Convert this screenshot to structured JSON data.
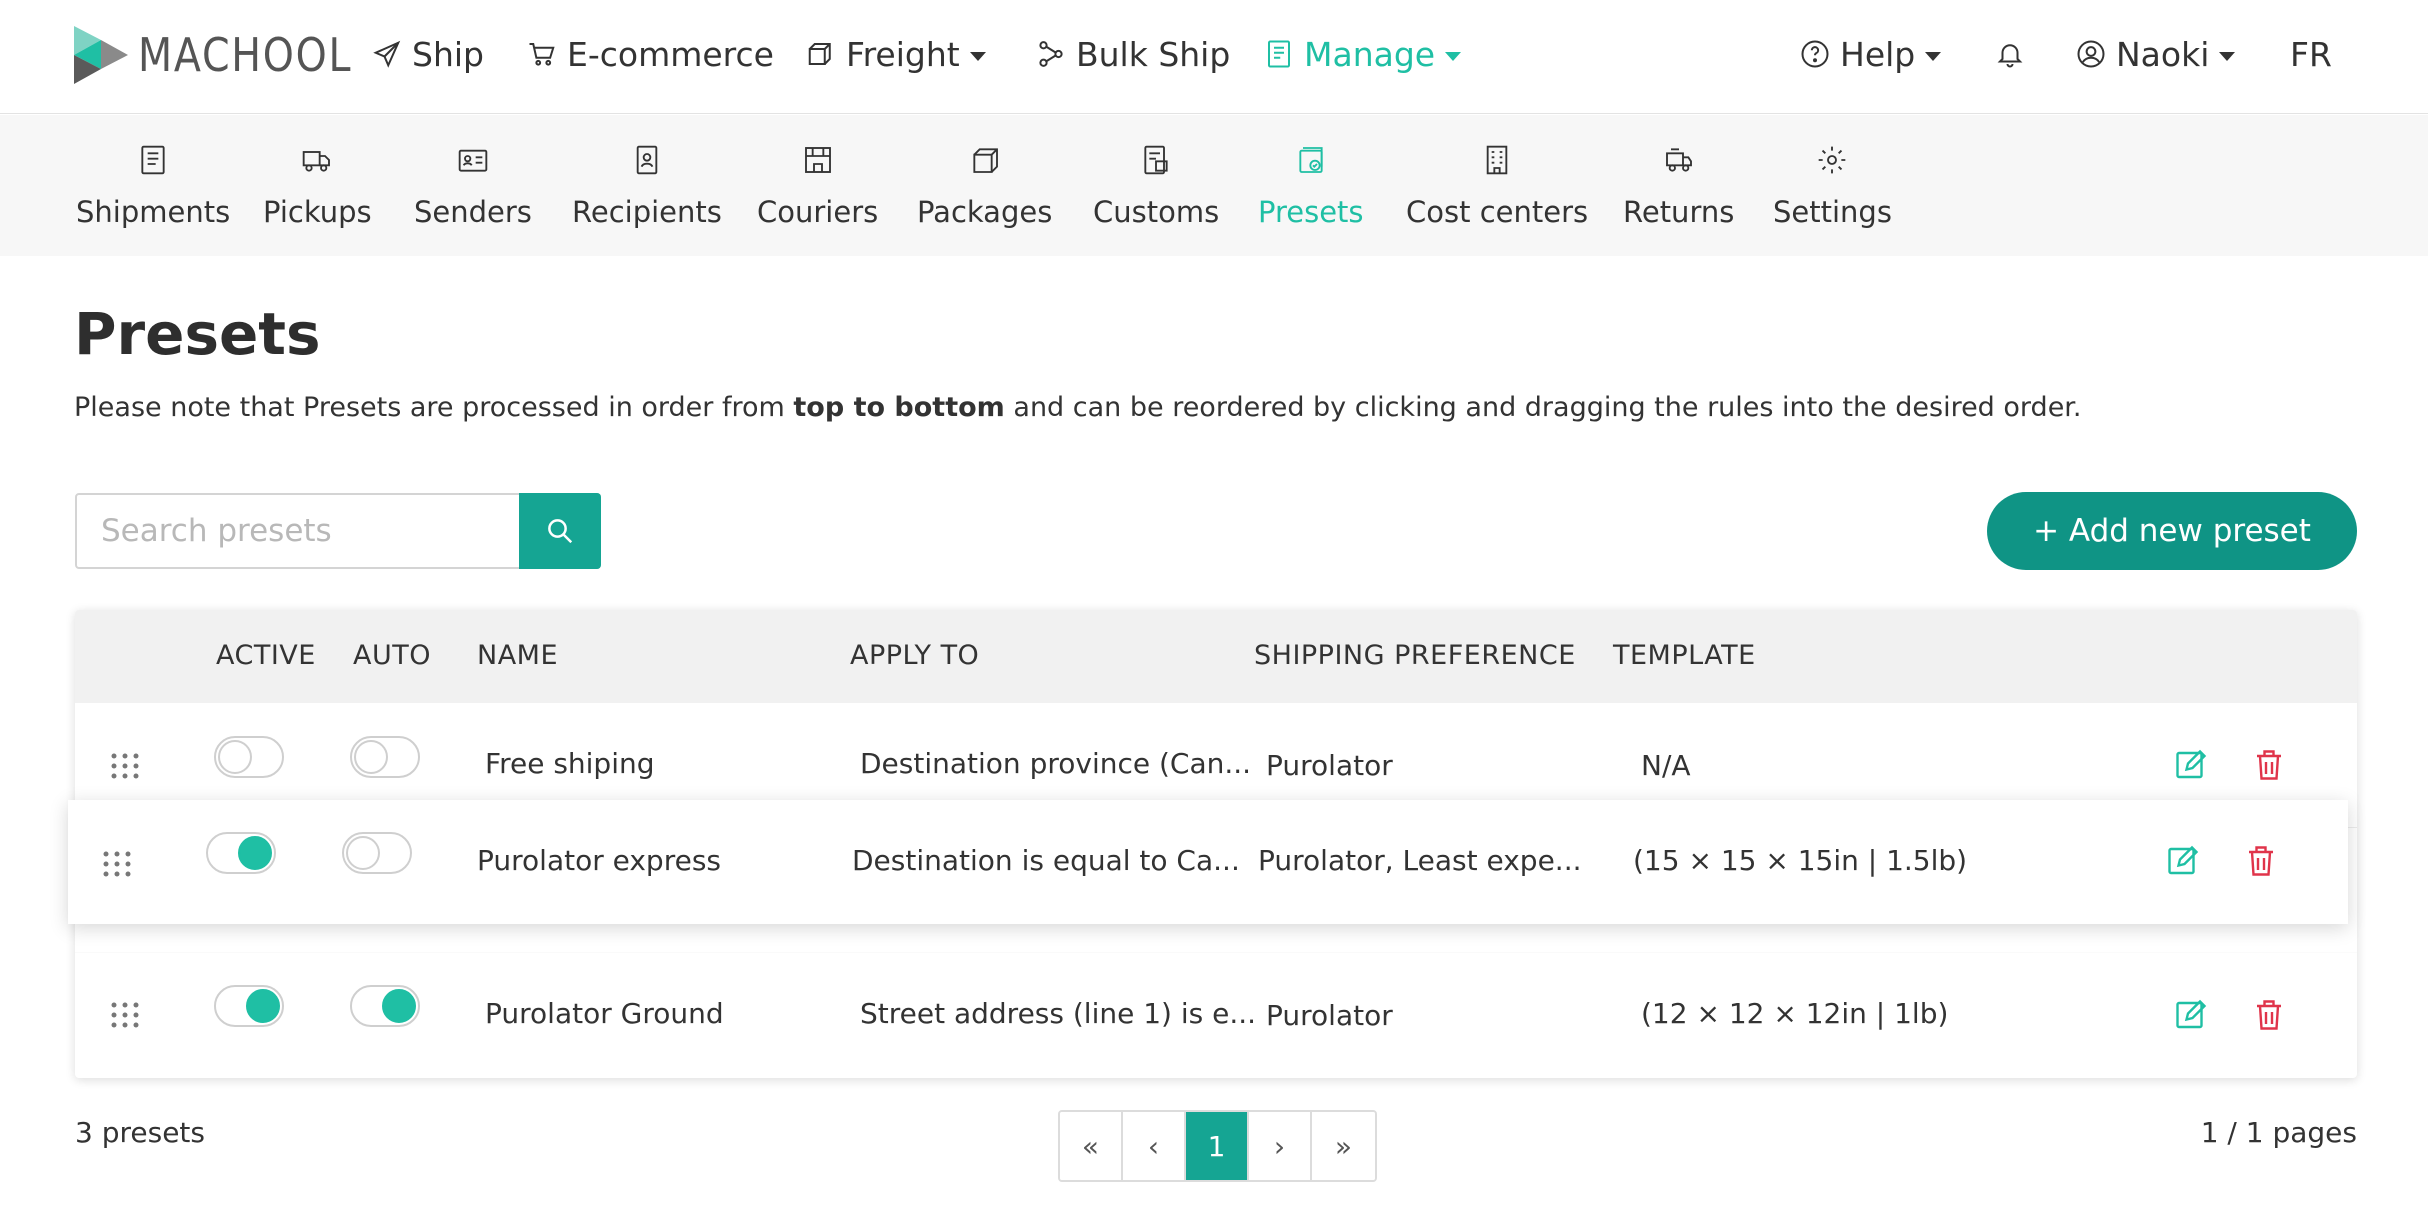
{
  "brand": {
    "name": "MACHOOL",
    "accent": "#1fbfa4",
    "primary": "#0f9485"
  },
  "topnav": {
    "items": [
      {
        "label": "Ship",
        "icon": "paper-plane-icon"
      },
      {
        "label": "E-commerce",
        "icon": "cart-icon"
      },
      {
        "label": "Freight",
        "icon": "boxes-icon",
        "dropdown": true
      },
      {
        "label": "Bulk Ship",
        "icon": "share-nodes-icon"
      },
      {
        "label": "Manage",
        "icon": "clipboard-icon",
        "dropdown": true,
        "active": true
      }
    ],
    "help_label": "Help",
    "user_label": "Naoki",
    "lang_label": "FR"
  },
  "subnav": {
    "items": [
      {
        "label": "Shipments",
        "icon": "list-document-icon"
      },
      {
        "label": "Pickups",
        "icon": "truck-icon"
      },
      {
        "label": "Senders",
        "icon": "address-card-icon"
      },
      {
        "label": "Recipients",
        "icon": "id-badge-icon"
      },
      {
        "label": "Couriers",
        "icon": "storefront-icon"
      },
      {
        "label": "Packages",
        "icon": "box-icon"
      },
      {
        "label": "Customs",
        "icon": "customs-document-icon"
      },
      {
        "label": "Presets",
        "icon": "preset-stack-icon",
        "active": true
      },
      {
        "label": "Cost centers",
        "icon": "building-icon"
      },
      {
        "label": "Returns",
        "icon": "return-truck-icon"
      },
      {
        "label": "Settings",
        "icon": "gear-icon"
      }
    ]
  },
  "page": {
    "title": "Presets",
    "note_pre": "Please note that Presets are processed in order from ",
    "note_bold": "top to bottom",
    "note_post": " and can be reordered by clicking and dragging the rules into the desired order."
  },
  "search": {
    "placeholder": "Search presets",
    "value": ""
  },
  "add_button_label": "+ Add new preset",
  "table": {
    "headers": {
      "active": "ACTIVE",
      "auto": "AUTO",
      "name": "NAME",
      "apply_to": "APPLY TO",
      "shipping_preference": "SHIPPING PREFERENCE",
      "template": "TEMPLATE"
    },
    "rows": [
      {
        "active": false,
        "auto": false,
        "name": "Free shiping",
        "apply_to": "Destination province (Can...",
        "shipping_preference": "Purolator",
        "template": "N/A"
      },
      {
        "active": true,
        "auto": false,
        "name": "Purolator express",
        "apply_to": "Destination is equal to Ca...",
        "shipping_preference": "Purolator, Least expe...",
        "template": "(15 × 15 × 15in | 1.5lb)",
        "dragging": true
      },
      {
        "active": true,
        "auto": true,
        "name": "Purolator Ground",
        "apply_to": "Street address (line 1) is e...",
        "shipping_preference": "Purolator",
        "template": "(12 × 12 × 12in | 1lb)"
      }
    ]
  },
  "footer": {
    "count_label": "3 presets",
    "pager": {
      "first": "«",
      "prev": "‹",
      "current": "1",
      "next": "›",
      "last": "»"
    },
    "pages_label": "1 / 1 pages"
  }
}
